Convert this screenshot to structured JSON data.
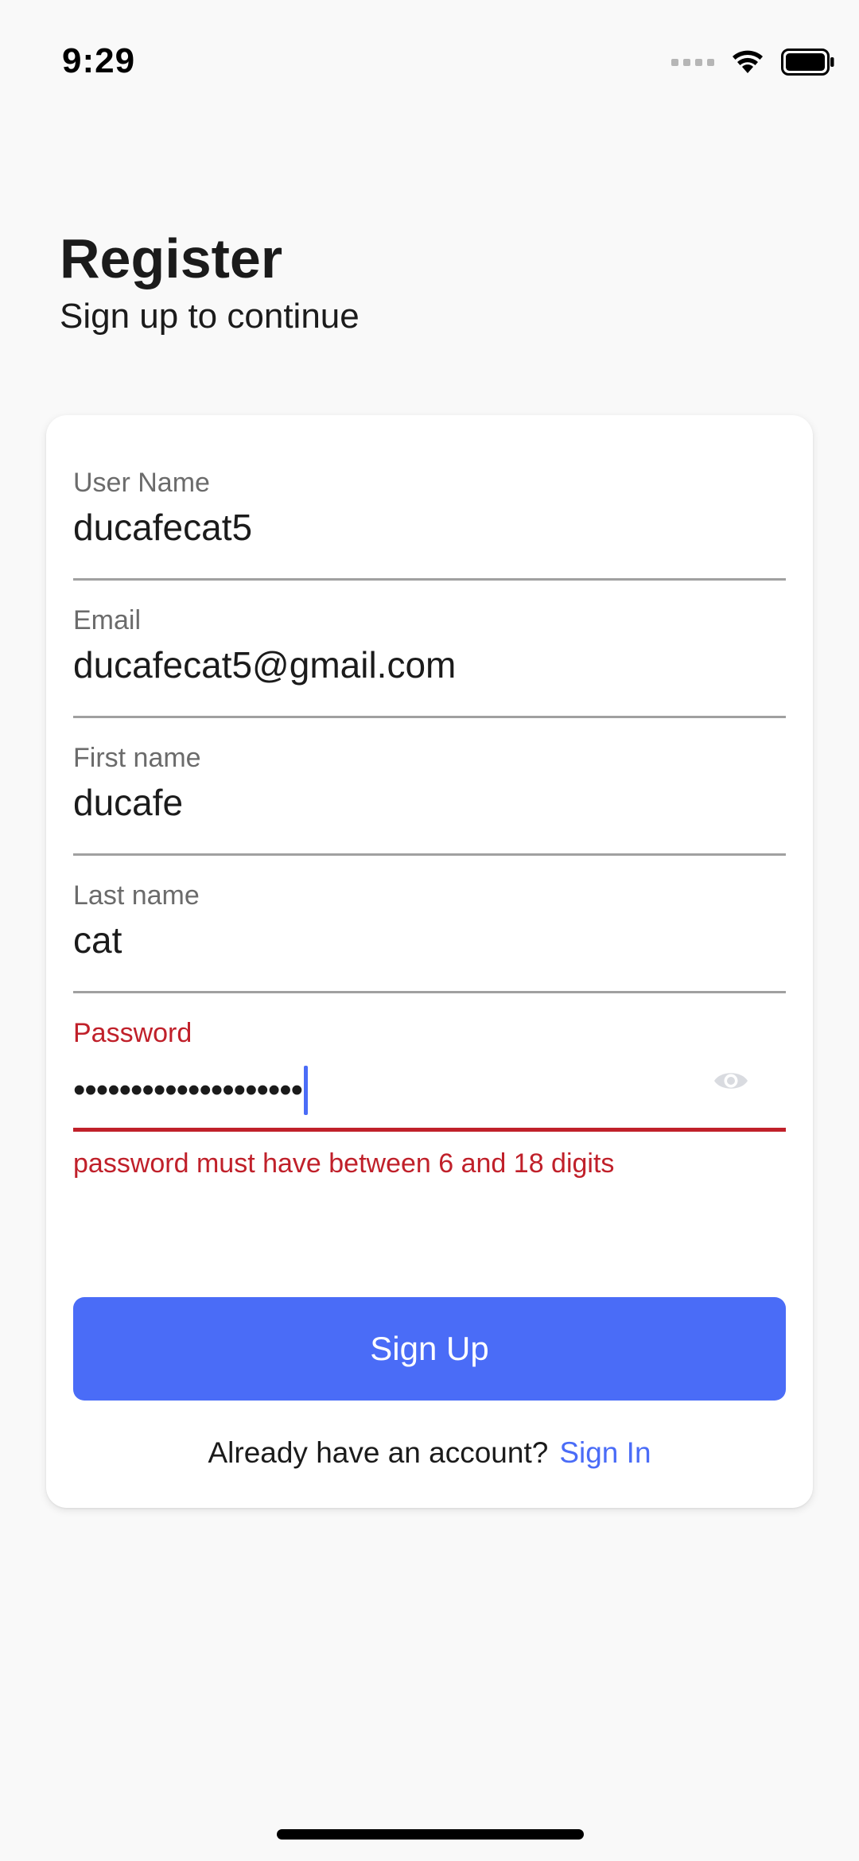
{
  "status_bar": {
    "time": "9:29"
  },
  "header": {
    "title": "Register",
    "subtitle": "Sign up to continue"
  },
  "form": {
    "username": {
      "label": "User Name",
      "value": "ducafecat5"
    },
    "email": {
      "label": "Email",
      "value": "ducafecat5@gmail.com"
    },
    "first_name": {
      "label": "First name",
      "value": "ducafe"
    },
    "last_name": {
      "label": "Last name",
      "value": "cat"
    },
    "password": {
      "label": "Password",
      "masked_value": "••••••••••••••••••••",
      "error": "password must have between 6 and 18 digits",
      "visibility_icon": "eye-icon"
    },
    "submit_label": "Sign Up",
    "signin_prompt": "Already have an account?",
    "signin_link": "Sign In"
  },
  "colors": {
    "accent": "#4a6cf7",
    "error": "#c0202a",
    "background": "#f9f9f9",
    "card": "#ffffff"
  }
}
